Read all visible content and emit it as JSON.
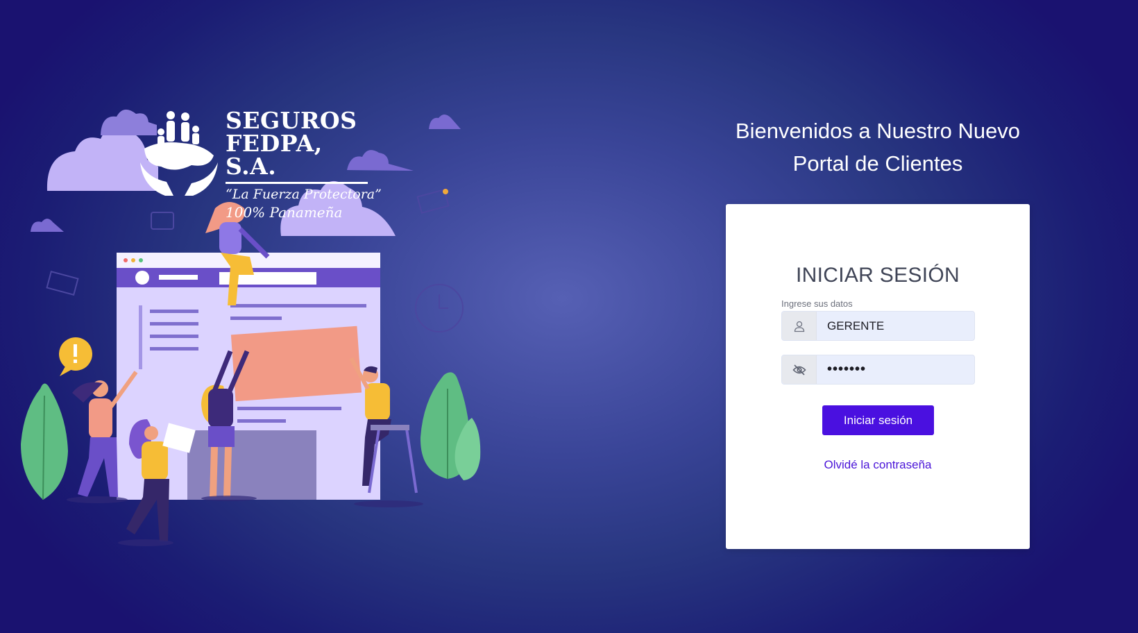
{
  "logo": {
    "line1": "SEGUROS",
    "line2": "FEDPA, S.A.",
    "tagline": "“La Fuerza Protectora”",
    "tagline2": "100% Panameña"
  },
  "welcome": {
    "line1": "Bienvenidos a Nuestro Nuevo",
    "line2": "Portal de Clientes"
  },
  "login": {
    "title": "INICIAR SESIÓN",
    "hint": "Ingrese sus datos",
    "username_value": "GERENTE",
    "password_value": "•••••••",
    "submit_label": "Iniciar sesión",
    "forgot_label": "Olvidé la contraseña"
  },
  "colors": {
    "accent": "#4a10e0",
    "link": "#4a14d8",
    "background": "#283680"
  },
  "icons": {
    "user_icon": "user-icon",
    "password_icon": "eye-off-icon"
  }
}
